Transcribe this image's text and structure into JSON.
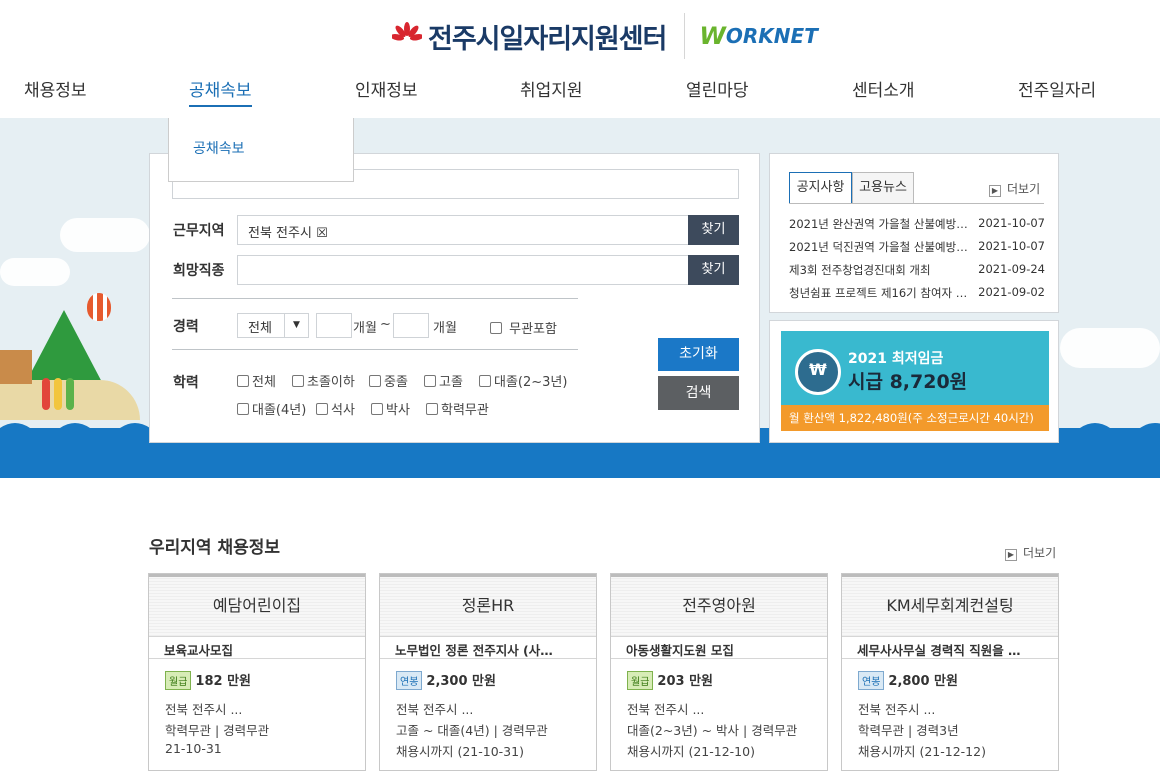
{
  "header": {
    "site_title": "전주시일자리지원센터",
    "partner_logo": "WORKNET",
    "partner_logo_first": "W",
    "partner_logo_rest": "ORKNET"
  },
  "nav": {
    "items": [
      "채용정보",
      "공채속보",
      "인재정보",
      "취업지원",
      "열린마당",
      "센터소개",
      "전주일자리"
    ],
    "active": "공채속보",
    "dropdown_items": [
      "공채속보"
    ]
  },
  "search": {
    "keyword_value": "",
    "region_label": "근무지역",
    "region_value": "전북 전주시 ☒",
    "job_label": "희망직종",
    "job_value": "",
    "find_label": "찾기",
    "career_label": "경력",
    "career_select": "전체",
    "month_unit": "개월",
    "tilde": "~",
    "career_irrelevant": "무관포함",
    "edu_label": "학력",
    "edu_options": [
      "전체",
      "초졸이하",
      "중졸",
      "고졸",
      "대졸(2~3년)",
      "대졸(4년)",
      "석사",
      "박사",
      "학력무관"
    ],
    "reset_label": "초기화",
    "search_label": "검색"
  },
  "notice": {
    "tabs": [
      "공지사항",
      "고용뉴스"
    ],
    "active_tab": "공지사항",
    "more": "더보기",
    "items": [
      {
        "title": "2021년 완산권역 가을철 산불예방 …",
        "date": "2021-10-07"
      },
      {
        "title": "2021년 덕진권역 가을철 산불예방 …",
        "date": "2021-10-07"
      },
      {
        "title": "제3회 전주창업경진대회 개최",
        "date": "2021-09-24"
      },
      {
        "title": "청년쉼표 프로젝트 제16기 참여자 …",
        "date": "2021-09-02"
      }
    ]
  },
  "banner": {
    "year_title": "2021 최저임금",
    "wage": "시급 8,720원",
    "monthly": "월 환산액 1,822,480원(주 소정근로시간 40시간)"
  },
  "jobs": {
    "section_title": "우리지역 채용정보",
    "more": "더보기",
    "cards": [
      {
        "company": "예담어린이집",
        "title": "보육교사모집",
        "pay_type": "월급",
        "pay": "182 만원",
        "region": "전북 전주시 ...",
        "req": "학력무관 | 경력무관",
        "deadline": "21-10-31"
      },
      {
        "company": "정론HR",
        "title": "노무법인 정론 전주지사 (사…",
        "pay_type": "연봉",
        "pay": "2,300 만원",
        "region": "전북 전주시 ...",
        "req": "고졸 ~ 대졸(4년) | 경력무관",
        "deadline": "채용시까지 (21-10-31)"
      },
      {
        "company": "전주영아원",
        "title": "아동생활지도원 모집",
        "pay_type": "월급",
        "pay": "203 만원",
        "region": "전북 전주시 ...",
        "req": "대졸(2~3년) ~ 박사 | 경력무관",
        "deadline": "채용시까지 (21-12-10)"
      },
      {
        "company": "KM세무회계컨설팅",
        "title": "세무사사무실 경력직 직원을 …",
        "pay_type": "연봉",
        "pay": "2,800 만원",
        "region": "전북 전주시 ...",
        "req": "학력무관 | 경력3년",
        "deadline": "채용시까지 (21-12-12)"
      }
    ]
  },
  "colors": {
    "accent": "#1b6fb5",
    "sea": "#1778c4",
    "banner": "#39b9cf",
    "banner_bar": "#f39a2b"
  }
}
